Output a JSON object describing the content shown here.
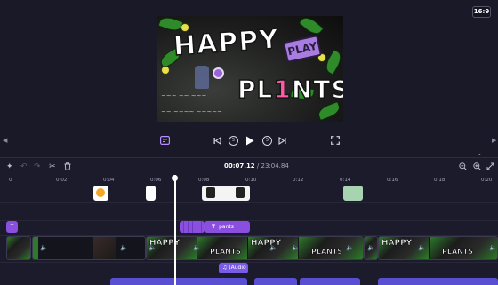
{
  "preview": {
    "aspect_ratio_label": "16:9",
    "video": {
      "title_word_1": "HAPPY",
      "badge": "PLAY",
      "title_word_2_a": "PL",
      "title_word_2_b": "1",
      "title_word_2_c": "NTS"
    }
  },
  "toolbar": {
    "current_time": "00:07.12",
    "separator": " / ",
    "total_time": "23:04.84"
  },
  "ruler": {
    "ticks": [
      "0",
      "0:02",
      "0:04",
      "0:06",
      "0:08",
      "0:10",
      "0:12",
      "0:14",
      "0:16",
      "0:18",
      "0:20"
    ]
  },
  "tracks": {
    "text_clip_label": "pants",
    "text_clip_icon": "T",
    "small_text_icon": "T",
    "audio_clip_label": "(Audio",
    "video_thumb_word_1": "HAPPY",
    "video_thumb_word_2": "PLANTS"
  },
  "colors": {
    "background": "#1c1b2b",
    "text_clip": "#8b4fe0",
    "audio_clip": "#7a5be8",
    "sticker_clip": "#ffffff",
    "playhead": "#ffffff"
  },
  "icons": [
    "captions-icon",
    "skip-back-icon",
    "rewind-5-icon",
    "play-icon",
    "forward-5-icon",
    "skip-forward-icon",
    "fullscreen-icon",
    "magic-icon",
    "undo-icon",
    "redo-icon",
    "split-icon",
    "delete-icon",
    "zoom-out-icon",
    "zoom-in-icon",
    "fit-icon",
    "speaker-icon",
    "music-icon"
  ]
}
